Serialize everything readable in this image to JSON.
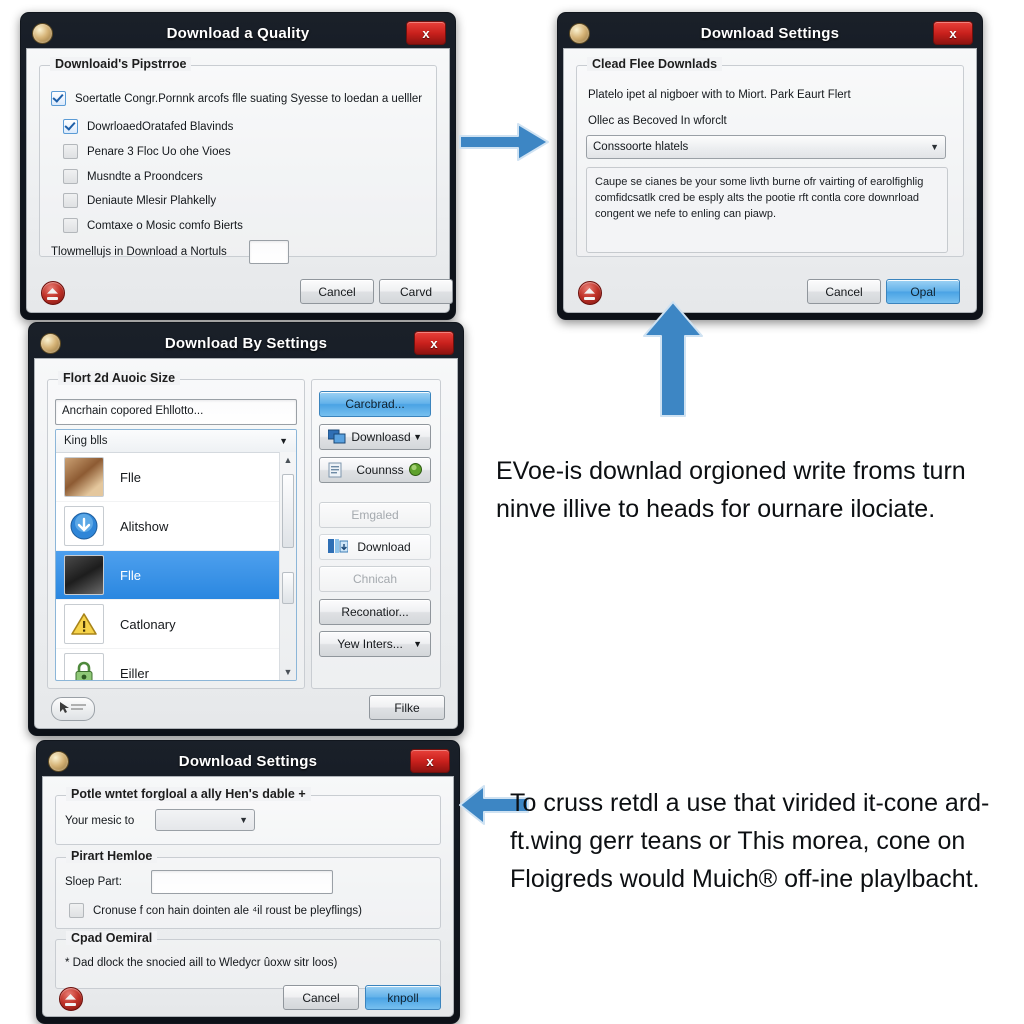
{
  "meta": {
    "accent_blue": "#3d86c4",
    "title_bar": "#121821",
    "close_red": "#c8201c",
    "selection_blue": "#2a87e0",
    "background": "#ffffff"
  },
  "dialog1": {
    "title": "Download a Quality",
    "app_icon": "app-globe-icon",
    "close_label": "x",
    "group_title": "Downloaid's Pipstrroe",
    "checkboxes": [
      {
        "label": "Soertatle Congr.Pornnk arcofs flle suating Syesse to loedan a uelller",
        "checked": true
      },
      {
        "label": "DowrloaedOratafed Blavinds",
        "checked": true
      },
      {
        "label": "Penare 3 Floc Uo ohe Vioes",
        "checked": false
      },
      {
        "label": "Musndte a Proondcers",
        "checked": false
      },
      {
        "label": "Deniaute Mlesir Plahkelly",
        "checked": false
      },
      {
        "label": "Comtaxe o Mosic comfo Bierts",
        "checked": false
      }
    ],
    "field_label": "Tlowmellujs in Download a Nortuls",
    "field_value": "",
    "buttons": [
      {
        "label": "Cancel",
        "style": "normal"
      },
      {
        "label": "Carvd",
        "style": "normal"
      }
    ]
  },
  "dialog2": {
    "title": "Download Settings",
    "app_icon": "app-globe-icon",
    "close_label": "x",
    "group_title": "Clead Flee Downlads",
    "line1": "Platelo ipet al nigboer with to Miort. Park Eaurt Flert",
    "line2": "Ollec as Becoved In wforclt",
    "combo_value": "Conssoorte hlatels",
    "combo_caret": "chevron-down-icon",
    "body_text": "Caupe se cianes be your some livth burne ofr vairting of earolfighlig comfidcsatlk cred be esply alts the pootie rft contla core downrload congent we nefe to enling can piawp.",
    "buttons": [
      {
        "label": "Cancel",
        "style": "normal"
      },
      {
        "label": "Opal",
        "style": "primary"
      }
    ]
  },
  "dialog3": {
    "title": "Download By Settings",
    "app_icon": "app-globe-icon",
    "close_label": "x",
    "group_title": "Flort 2d Auoic Size",
    "path_value": "Ancrhain copored Ehllotto...",
    "list_header": "King blls",
    "list_header_caret": "chevron-down-icon",
    "items": [
      {
        "label": "Flle",
        "icon": "photo-thumbnail-icon",
        "selected": false
      },
      {
        "label": "Alitshow",
        "icon": "blue-download-circle-icon",
        "selected": false
      },
      {
        "label": "Flle",
        "icon": "photo-thumbnail-icon",
        "selected": true
      },
      {
        "label": "Catlonary",
        "icon": "warning-triangle-icon",
        "selected": false
      },
      {
        "label": "Eiller",
        "icon": "green-lock-icon",
        "selected": false
      }
    ],
    "scroll_up": "scroll-up-arrow-icon",
    "scroll_down": "scroll-down-arrow-icon",
    "side_buttons": [
      {
        "label": "Carcbrad...",
        "style": "primary",
        "icon": "",
        "caret": false
      },
      {
        "label": "Downloasd",
        "style": "normal",
        "icon": "window-stack-icon",
        "caret": true
      },
      {
        "label": "Counnss",
        "style": "normal",
        "icon": "document-icon",
        "caret": false,
        "badge": "green-orb-icon"
      },
      {
        "label": "Emgaled",
        "style": "disabled",
        "icon": "",
        "caret": false
      },
      {
        "label": "Download",
        "style": "flat",
        "icon": "download-tiles-icon",
        "caret": false
      },
      {
        "label": "Chnicah",
        "style": "disabled",
        "icon": "",
        "caret": false
      },
      {
        "label": "Reconatior...",
        "style": "normal",
        "icon": "",
        "caret": false
      },
      {
        "label": "Yew Inters...",
        "style": "normal",
        "icon": "",
        "caret": true
      }
    ],
    "status_icon": "mouse-pointer-badge-icon",
    "footer_button": {
      "label": "Filke",
      "style": "normal"
    }
  },
  "dialog4": {
    "title": "Download Settings",
    "app_icon": "app-globe-icon",
    "close_label": "x",
    "group1_title": "Potle wntet forgloal a ally Hen's dable +",
    "music_label": "Your mesic to",
    "music_combo_value": "",
    "music_caret": "chevron-down-icon",
    "group2_title": "Pirart Hemloe",
    "step_label": "Sloep Part:",
    "step_value": "",
    "checkbox": {
      "label": "Cronuse f con hain dointen ale ⁴il roust be pleyflings)",
      "checked": true
    },
    "group3_title": "Cpad Oemiral",
    "group3_text": "* Dad dlock the snocied aill to Wledycr ûoxw sitr loos)",
    "buttons": [
      {
        "label": "Cancel",
        "style": "normal"
      },
      {
        "label": "knpoll",
        "style": "primary"
      }
    ]
  },
  "arrows": [
    {
      "name": "arrow-right-top",
      "direction": "right"
    },
    {
      "name": "arrow-up-middle",
      "direction": "up"
    },
    {
      "name": "arrow-left-bottom",
      "direction": "left"
    }
  ],
  "annotations": {
    "middle": "EVoe-is downlad orgioned write froms turn ninve illive to heads for ournare ilociate.",
    "bottom": "To cruss retdl a use that virided it-cone ard-ft.wing gerr teans or This morea, cone on Floigreds would Muich® off-ine playlbacht."
  }
}
